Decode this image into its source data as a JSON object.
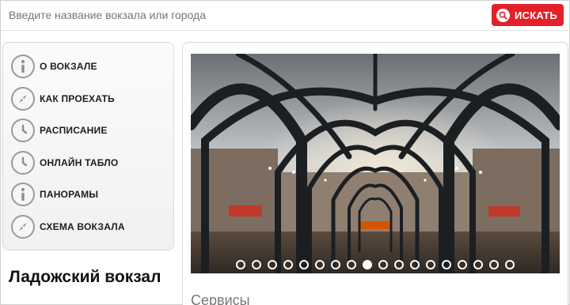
{
  "search": {
    "placeholder": "Введите название вокзала или города",
    "button_label": "ИСКАТЬ"
  },
  "sidebar": {
    "items": [
      {
        "label": "О ВОКЗАЛЕ",
        "icon": "info-icon"
      },
      {
        "label": "КАК ПРОЕХАТЬ",
        "icon": "compass-icon"
      },
      {
        "label": "РАСПИСАНИЕ",
        "icon": "clock-icon"
      },
      {
        "label": "ОНЛАЙН ТАБЛО",
        "icon": "clock-icon"
      },
      {
        "label": "ПАНОРАМЫ",
        "icon": "info-icon"
      },
      {
        "label": "СХЕМА ВОКЗАЛА",
        "icon": "compass-icon"
      }
    ]
  },
  "station": {
    "title": "Ладожский вокзал"
  },
  "gallery": {
    "slide_count": 18,
    "active_index": 8
  },
  "main": {
    "section_title": "Сервисы"
  },
  "colors": {
    "accent": "#e32129",
    "icon_border": "#9a9a9a",
    "text_dark": "#1d1d1d"
  }
}
